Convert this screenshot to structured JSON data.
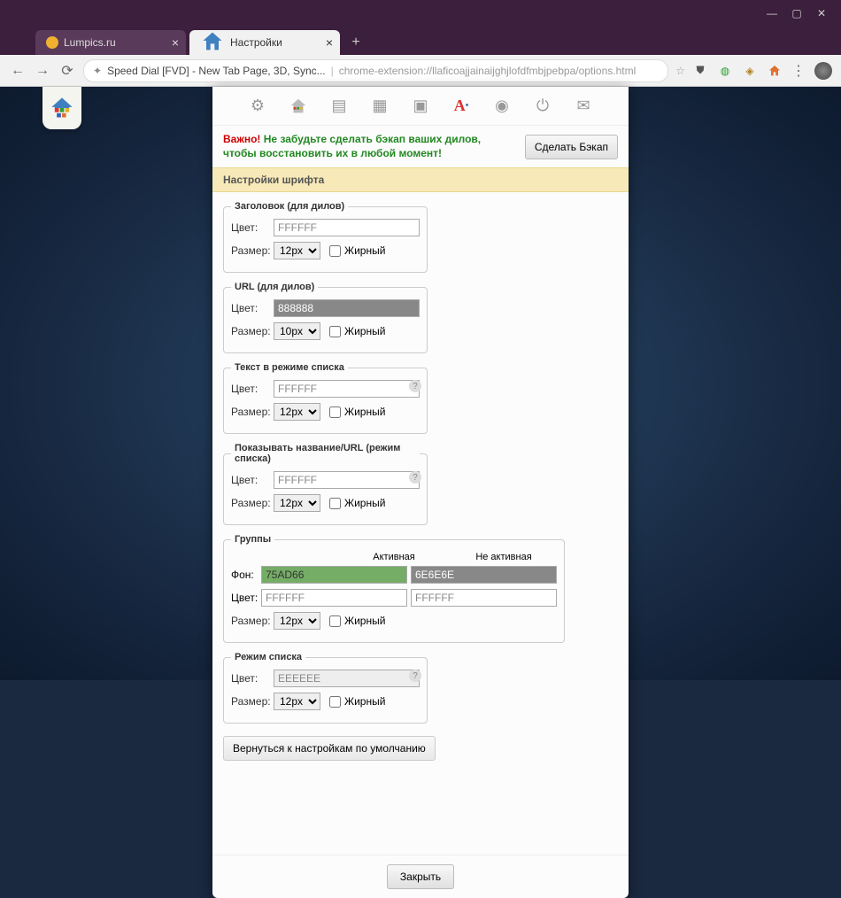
{
  "window": {
    "minimize": "—",
    "maximize": "▢",
    "close": "✕"
  },
  "tabs": [
    {
      "title": "Lumpics.ru",
      "active": false
    },
    {
      "title": "Настройки",
      "active": true
    }
  ],
  "new_tab": "+",
  "nav": {
    "back": "←",
    "forward": "→",
    "reload": "⟳"
  },
  "url": {
    "title": "Speed Dial [FVD] - New Tab Page, 3D, Sync...",
    "path": "chrome-extension://llaficoajjainaijghjlofdfmbjpebpa/options.html"
  },
  "ext_icons": [
    "star",
    "shield",
    "globe",
    "cube",
    "home"
  ],
  "home_badge_icon": "home",
  "toolbar_icons": [
    "gear",
    "home",
    "page",
    "image",
    "tv",
    "font",
    "power",
    "power2",
    "mail"
  ],
  "warning": {
    "important": "Важно!",
    "msg": "Не забудьте сделать бэкап ваших дилов, чтобы восстановить их в любой момент!",
    "backup_btn": "Сделать Бэкап"
  },
  "section_title": "Настройки шрифта",
  "labels": {
    "color": "Цвет:",
    "size": "Размер:",
    "bold": "Жирный",
    "bg": "Фон:",
    "active": "Активная",
    "inactive": "Не активная"
  },
  "fieldsets": {
    "heading": {
      "legend": "Заголовок (для дилов)",
      "color": "FFFFFF",
      "size": "12px"
    },
    "url": {
      "legend": "URL (для дилов)",
      "color": "888888",
      "size": "10px"
    },
    "list_text": {
      "legend": "Текст в режиме списка",
      "color": "FFFFFF",
      "size": "12px"
    },
    "show_title": {
      "legend": "Показывать название/URL (режим списка)",
      "color": "FFFFFF",
      "size": "12px"
    },
    "groups": {
      "legend": "Группы",
      "active_bg": "75AD66",
      "inactive_bg": "6E6E6E",
      "active_color": "FFFFFF",
      "inactive_color": "FFFFFF",
      "size": "12px"
    },
    "list_mode": {
      "legend": "Режим списка",
      "color": "EEEEEE",
      "size": "12px"
    }
  },
  "reset_btn": "Вернуться к настройкам по умолчанию",
  "close_btn": "Закрыть"
}
